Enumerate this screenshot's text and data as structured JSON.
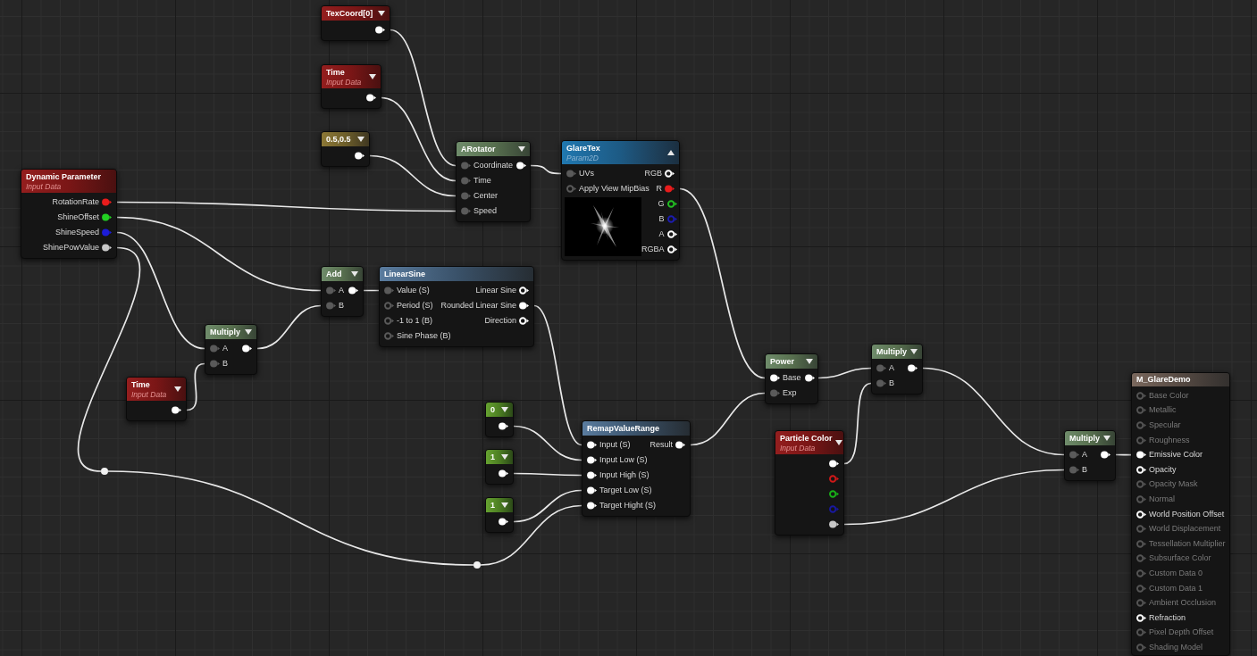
{
  "nodes": [
    {
      "kind": "input",
      "title": "TexCoord[0]",
      "expanded": false,
      "outputs": [
        {
          "connected": true,
          "color": "#ffffff"
        }
      ]
    },
    {
      "kind": "input",
      "title": "Time",
      "subtitle": "Input Data",
      "expanded": false,
      "outputs": [
        {
          "connected": true,
          "color": "#ffffff"
        }
      ]
    },
    {
      "kind": "vector_constant",
      "title": "0.5,0.5",
      "expanded": false,
      "outputs": [
        {
          "connected": true,
          "color": "#ffffff"
        }
      ]
    },
    {
      "kind": "input",
      "title": "Dynamic Parameter",
      "subtitle": "Input Data",
      "outputs": [
        {
          "label": "RotationRate",
          "connected": true,
          "color": "#e81c1c"
        },
        {
          "label": "ShineOffset",
          "connected": true,
          "color": "#22d022"
        },
        {
          "label": "ShineSpeed",
          "connected": true,
          "color": "#1c1cd8"
        },
        {
          "label": "ShinePowValue",
          "connected": true,
          "color": "#c8c8c8"
        }
      ]
    },
    {
      "kind": "math",
      "title": "ARotator",
      "expanded": false,
      "inputs": [
        {
          "label": "Coordinate",
          "connected": true,
          "color": "#5a5a5a"
        },
        {
          "label": "Time",
          "connected": true,
          "color": "#5a5a5a"
        },
        {
          "label": "Center",
          "connected": true,
          "color": "#5a5a5a"
        },
        {
          "label": "Speed",
          "connected": true,
          "color": "#5a5a5a"
        }
      ],
      "outputs": [
        {
          "connected": true,
          "color": "#ffffff"
        }
      ]
    },
    {
      "kind": "texture",
      "title": "GlareTex",
      "subtitle": "Param2D",
      "expanded": true,
      "inputs": [
        {
          "label": "UVs",
          "connected": true,
          "color": "#5a5a5a"
        },
        {
          "label": "Apply View MipBias",
          "connected": false,
          "color": "#5a5a5a"
        }
      ],
      "outputs": [
        {
          "label": "RGB",
          "connected": false,
          "color": "#ffffff"
        },
        {
          "label": "R",
          "connected": true,
          "color": "#e81c1c"
        },
        {
          "label": "G",
          "connected": false,
          "color": "#22c022"
        },
        {
          "label": "B",
          "connected": false,
          "color": "#1c1cb0"
        },
        {
          "label": "A",
          "connected": false,
          "color": "#ffffff"
        },
        {
          "label": "RGBA",
          "connected": false,
          "color": "#ffffff"
        }
      ]
    },
    {
      "kind": "math",
      "title": "Add",
      "expanded": false,
      "inputs": [
        {
          "label": "A",
          "connected": true,
          "color": "#5a5a5a"
        },
        {
          "label": "B",
          "connected": true,
          "color": "#5a5a5a"
        }
      ],
      "outputs": [
        {
          "connected": true,
          "color": "#ffffff"
        }
      ]
    },
    {
      "kind": "math",
      "title": "Multiply",
      "expanded": false,
      "inputs": [
        {
          "label": "A",
          "connected": true,
          "color": "#5a5a5a"
        },
        {
          "label": "B",
          "connected": true,
          "color": "#5a5a5a"
        }
      ],
      "outputs": [
        {
          "connected": true,
          "color": "#ffffff"
        }
      ]
    },
    {
      "kind": "function",
      "title": "LinearSine",
      "inputs": [
        {
          "label": "Value (S)",
          "connected": true,
          "color": "#5a5a5a"
        },
        {
          "label": "Period (S)",
          "connected": false,
          "color": "#5a5a5a"
        },
        {
          "label": "-1 to 1 (B)",
          "connected": false,
          "color": "#5a5a5a"
        },
        {
          "label": "Sine Phase (B)",
          "connected": false,
          "color": "#5a5a5a"
        }
      ],
      "outputs": [
        {
          "label": "Linear Sine",
          "connected": false,
          "color": "#ffffff"
        },
        {
          "label": "Rounded Linear Sine",
          "connected": true,
          "color": "#ffffff"
        },
        {
          "label": "Direction",
          "connected": false,
          "color": "#ffffff"
        }
      ]
    },
    {
      "kind": "input",
      "title": "Time",
      "subtitle": "Input Data",
      "expanded": false,
      "outputs": [
        {
          "connected": true,
          "color": "#ffffff"
        }
      ]
    },
    {
      "kind": "math",
      "title": "Power",
      "expanded": false,
      "inputs": [
        {
          "label": "Base",
          "connected": true,
          "color": "#ffffff"
        },
        {
          "label": "Exp",
          "connected": true,
          "color": "#5a5a5a"
        }
      ],
      "outputs": [
        {
          "connected": true,
          "color": "#ffffff"
        }
      ]
    },
    {
      "kind": "math",
      "title": "Multiply",
      "expanded": false,
      "inputs": [
        {
          "label": "A",
          "connected": true,
          "color": "#5a5a5a"
        },
        {
          "label": "B",
          "connected": true,
          "color": "#5a5a5a"
        }
      ],
      "outputs": [
        {
          "connected": true,
          "color": "#ffffff"
        }
      ]
    },
    {
      "kind": "scalar_constant",
      "title": "0",
      "expanded": false,
      "outputs": [
        {
          "connected": true,
          "color": "#ffffff"
        }
      ]
    },
    {
      "kind": "scalar_constant",
      "title": "1",
      "expanded": false,
      "outputs": [
        {
          "connected": true,
          "color": "#ffffff"
        }
      ]
    },
    {
      "kind": "scalar_constant",
      "title": "1",
      "expanded": false,
      "outputs": [
        {
          "connected": true,
          "color": "#ffffff"
        }
      ]
    },
    {
      "kind": "function",
      "title": "RemapValueRange",
      "inputs": [
        {
          "label": "Input (S)",
          "connected": true,
          "color": "#ffffff"
        },
        {
          "label": "Input Low (S)",
          "connected": true,
          "color": "#ffffff"
        },
        {
          "label": "Input High (S)",
          "connected": true,
          "color": "#ffffff"
        },
        {
          "label": "Target Low (S)",
          "connected": true,
          "color": "#ffffff"
        },
        {
          "label": "Target Hight (S)",
          "connected": true,
          "color": "#ffffff"
        }
      ],
      "outputs": [
        {
          "label": "Result",
          "connected": true,
          "color": "#ffffff"
        }
      ]
    },
    {
      "kind": "input",
      "title": "Particle Color",
      "subtitle": "Input Data",
      "expanded": false,
      "outputs": [
        {
          "connected": true,
          "color": "#ffffff"
        },
        {
          "connected": false,
          "color": "#d01818"
        },
        {
          "connected": false,
          "color": "#18b018"
        },
        {
          "connected": false,
          "color": "#1818a0"
        },
        {
          "connected": true,
          "color": "#c8c8c8"
        }
      ]
    },
    {
      "kind": "math",
      "title": "Multiply",
      "expanded": false,
      "inputs": [
        {
          "label": "A",
          "connected": true,
          "color": "#5a5a5a"
        },
        {
          "label": "B",
          "connected": true,
          "color": "#5a5a5a"
        }
      ],
      "outputs": [
        {
          "connected": true,
          "color": "#ffffff"
        }
      ]
    },
    {
      "kind": "result",
      "title": "M_GlareDemo",
      "inputs": [
        {
          "label": "Base Color",
          "connected": false,
          "disabled": true,
          "color": "#555555"
        },
        {
          "label": "Metallic",
          "connected": false,
          "disabled": true,
          "color": "#555555"
        },
        {
          "label": "Specular",
          "connected": false,
          "disabled": true,
          "color": "#555555"
        },
        {
          "label": "Roughness",
          "connected": false,
          "disabled": true,
          "color": "#555555"
        },
        {
          "label": "Emissive Color",
          "connected": true,
          "disabled": false,
          "color": "#ffffff"
        },
        {
          "label": "Opacity",
          "connected": false,
          "disabled": false,
          "color": "#ffffff"
        },
        {
          "label": "Opacity Mask",
          "connected": false,
          "disabled": true,
          "color": "#555555"
        },
        {
          "label": "Normal",
          "connected": false,
          "disabled": true,
          "color": "#555555"
        },
        {
          "label": "World Position Offset",
          "connected": false,
          "disabled": false,
          "color": "#ffffff"
        },
        {
          "label": "World Displacement",
          "connected": false,
          "disabled": true,
          "color": "#555555"
        },
        {
          "label": "Tessellation Multiplier",
          "connected": false,
          "disabled": true,
          "color": "#555555"
        },
        {
          "label": "Subsurface Color",
          "connected": false,
          "disabled": true,
          "color": "#555555"
        },
        {
          "label": "Custom Data 0",
          "connected": false,
          "disabled": true,
          "color": "#555555"
        },
        {
          "label": "Custom Data 1",
          "connected": false,
          "disabled": true,
          "color": "#555555"
        },
        {
          "label": "Ambient Occlusion",
          "connected": false,
          "disabled": true,
          "color": "#555555"
        },
        {
          "label": "Refraction",
          "connected": false,
          "disabled": false,
          "color": "#ffffff"
        },
        {
          "label": "Pixel Depth Offset",
          "connected": false,
          "disabled": true,
          "color": "#555555"
        },
        {
          "label": "Shading Model",
          "connected": false,
          "disabled": true,
          "color": "#555555"
        }
      ]
    }
  ]
}
